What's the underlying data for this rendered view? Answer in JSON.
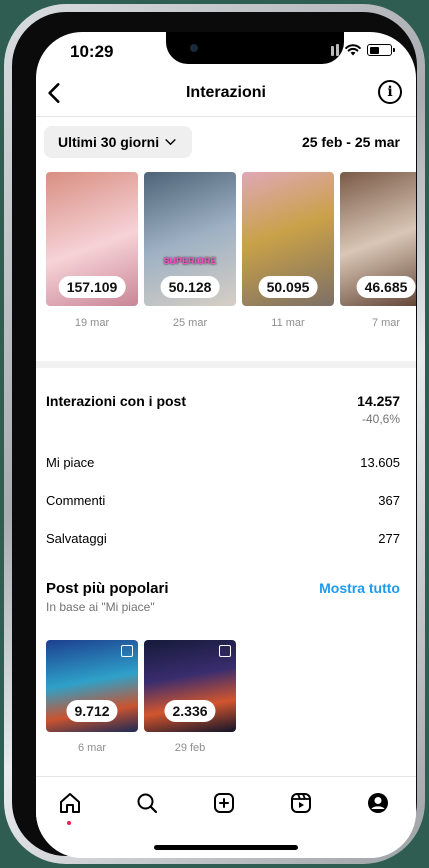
{
  "status": {
    "time": "10:29"
  },
  "header": {
    "title": "Interazioni",
    "back_icon": "chevron-left-icon",
    "info_icon": "info-icon"
  },
  "filter": {
    "label": "Ultimi 30 giorni",
    "date_range": "25 feb - 25 mar"
  },
  "top_posts": [
    {
      "count": "157.109",
      "date": "19 mar",
      "tag": "",
      "colors": [
        "#e8a99b",
        "#f3c9cf"
      ]
    },
    {
      "count": "50.128",
      "date": "25 mar",
      "tag": "SUPERIORE",
      "colors": [
        "#6a7f94",
        "#c8c2b8"
      ]
    },
    {
      "count": "50.095",
      "date": "11 mar",
      "tag": "",
      "colors": [
        "#d99aa9",
        "#c9a44a"
      ]
    },
    {
      "count": "46.685",
      "date": "7 mar",
      "tag": "",
      "colors": [
        "#8b6b55",
        "#e0cfc0"
      ]
    }
  ],
  "interactions": {
    "title": "Interazioni con i post",
    "total": "14.257",
    "change": "-40,6%",
    "rows": [
      {
        "label": "Mi piace",
        "value": "13.605"
      },
      {
        "label": "Commenti",
        "value": "367"
      },
      {
        "label": "Salvataggi",
        "value": "277"
      }
    ]
  },
  "popular": {
    "title": "Post più popolari",
    "subtitle": "In base ai \"Mi piace\"",
    "link": "Mostra tutto",
    "posts": [
      {
        "count": "9.712",
        "date": "6 mar"
      },
      {
        "count": "2.336",
        "date": "29 feb"
      }
    ]
  },
  "tabbar": {
    "items": [
      "home-icon",
      "search-icon",
      "create-icon",
      "reels-icon",
      "profile-icon"
    ],
    "active": "home-icon"
  }
}
